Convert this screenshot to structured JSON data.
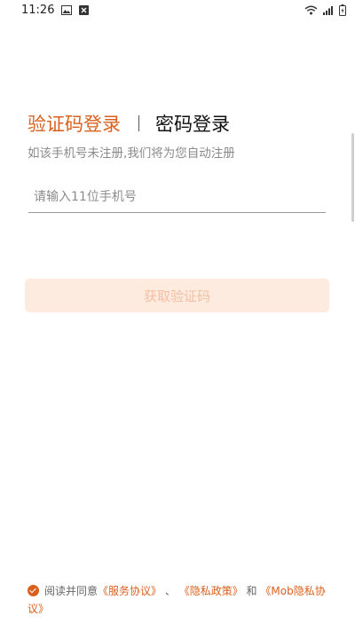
{
  "status_bar": {
    "time": "11:26",
    "left_icons": [
      "image-icon",
      "close-box-icon"
    ],
    "right_icons": [
      "wifi-icon",
      "signal-icon",
      "battery-icon"
    ]
  },
  "tabs": {
    "active_label": "验证码登录",
    "inactive_label": "密码登录"
  },
  "subtitle": "如该手机号未注册,我们将为您自动注册",
  "phone": {
    "value": "",
    "placeholder": "请输入11位手机号"
  },
  "get_code_label": "获取验证码",
  "agreement": {
    "checked": true,
    "prefix": "阅读并同意",
    "service_link": "《服务协议》",
    "sep": "、",
    "privacy_link": "《隐私政策》",
    "and": "和",
    "mob_link": "《Mob隐私协议》"
  },
  "colors": {
    "accent": "#d9601f",
    "button_bg": "#fdebe0",
    "button_text": "#f4bfa3"
  }
}
